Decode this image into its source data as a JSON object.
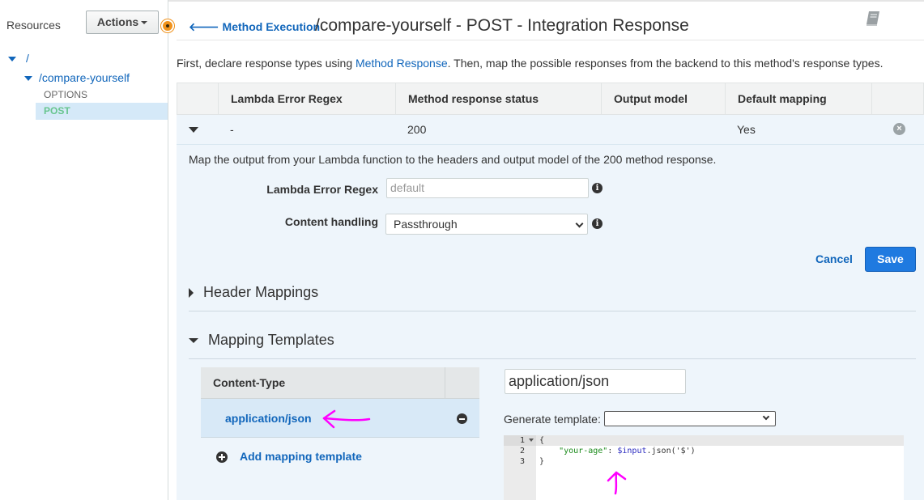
{
  "sidebar": {
    "title": "Resources",
    "actions_label": "Actions",
    "tree": {
      "root": "/",
      "resource": "/compare-yourself",
      "methods": [
        "OPTIONS",
        "POST"
      ]
    }
  },
  "header": {
    "back_label": "Method Execution",
    "title": "/compare-yourself - POST - Integration Response"
  },
  "intro": {
    "before": "First, declare response types using ",
    "link": "Method Response",
    "after": ". Then, map the possible responses from the backend to this method's response types."
  },
  "table": {
    "columns": [
      "Lambda Error Regex",
      "Method response status",
      "Output model",
      "Default mapping"
    ],
    "rows": [
      {
        "regex": "-",
        "status": "200",
        "output_model": "",
        "default_mapping": "Yes"
      }
    ]
  },
  "panel": {
    "description": "Map the output from your Lambda function to the headers and output model of the 200 method response.",
    "regex_label": "Lambda Error Regex",
    "regex_placeholder": "default",
    "content_handling_label": "Content handling",
    "content_handling_value": "Passthrough",
    "cancel_label": "Cancel",
    "save_label": "Save"
  },
  "header_mappings": {
    "title": "Header Mappings"
  },
  "mapping_templates": {
    "title": "Mapping Templates",
    "column": "Content-Type",
    "items": [
      "application/json"
    ],
    "add_label": "Add mapping template",
    "content_type_value": "application/json",
    "generate_label": "Generate template:",
    "generate_value": ""
  },
  "editor": {
    "line_numbers": [
      "1",
      "2",
      "3"
    ],
    "lines": {
      "l1": "{",
      "l2_indent": "    ",
      "l2_key": "\"your-age\"",
      "l2_colon": ": ",
      "l2_var": "$input",
      "l2_rest": ".json('$')",
      "l3": "}"
    }
  },
  "colors": {
    "link": "#1166bb",
    "primary_button": "#1f7ae0",
    "panel_bg": "#eef5fb",
    "annotation": "#ff00ff",
    "post_method": "#67c58e",
    "actions_indicator": "#f0921c"
  },
  "icons": [
    "book-icon",
    "arrow-left-icon",
    "info-icon",
    "remove-icon",
    "minus-icon",
    "plus-icon",
    "caret-down-icon",
    "caret-right-icon",
    "chevron-down-icon"
  ]
}
